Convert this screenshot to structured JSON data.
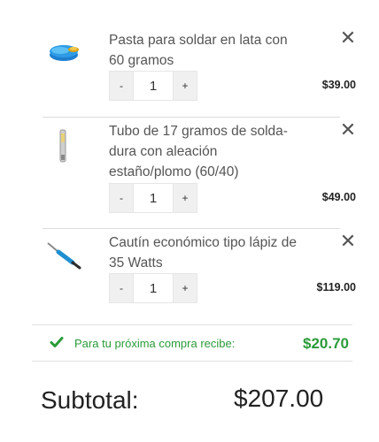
{
  "cart": {
    "items": [
      {
        "name": "Pasta para soldar en lata con 60 gramos",
        "quantity": "1",
        "price": "$39.00",
        "image_icon": "solder-paste-tin-icon"
      },
      {
        "name": "Tubo de 17 gramos de solda-dura con aleación estaño/plomo (60/40)",
        "quantity": "1",
        "price": "$49.00",
        "image_icon": "solder-tube-icon"
      },
      {
        "name": "Cautín económico tipo lápiz de 35 Watts",
        "quantity": "1",
        "price": "$119.00",
        "image_icon": "soldering-iron-icon"
      }
    ],
    "minus_label": "-",
    "plus_label": "+",
    "remove_icon": "close-icon"
  },
  "reward": {
    "label": "Para tu próxima compra recibe:",
    "amount": "$20.70",
    "icon": "check-icon",
    "color": "#2b9b3a"
  },
  "summary": {
    "subtotal_label": "Subtotal:",
    "subtotal_value": "$207.00"
  }
}
